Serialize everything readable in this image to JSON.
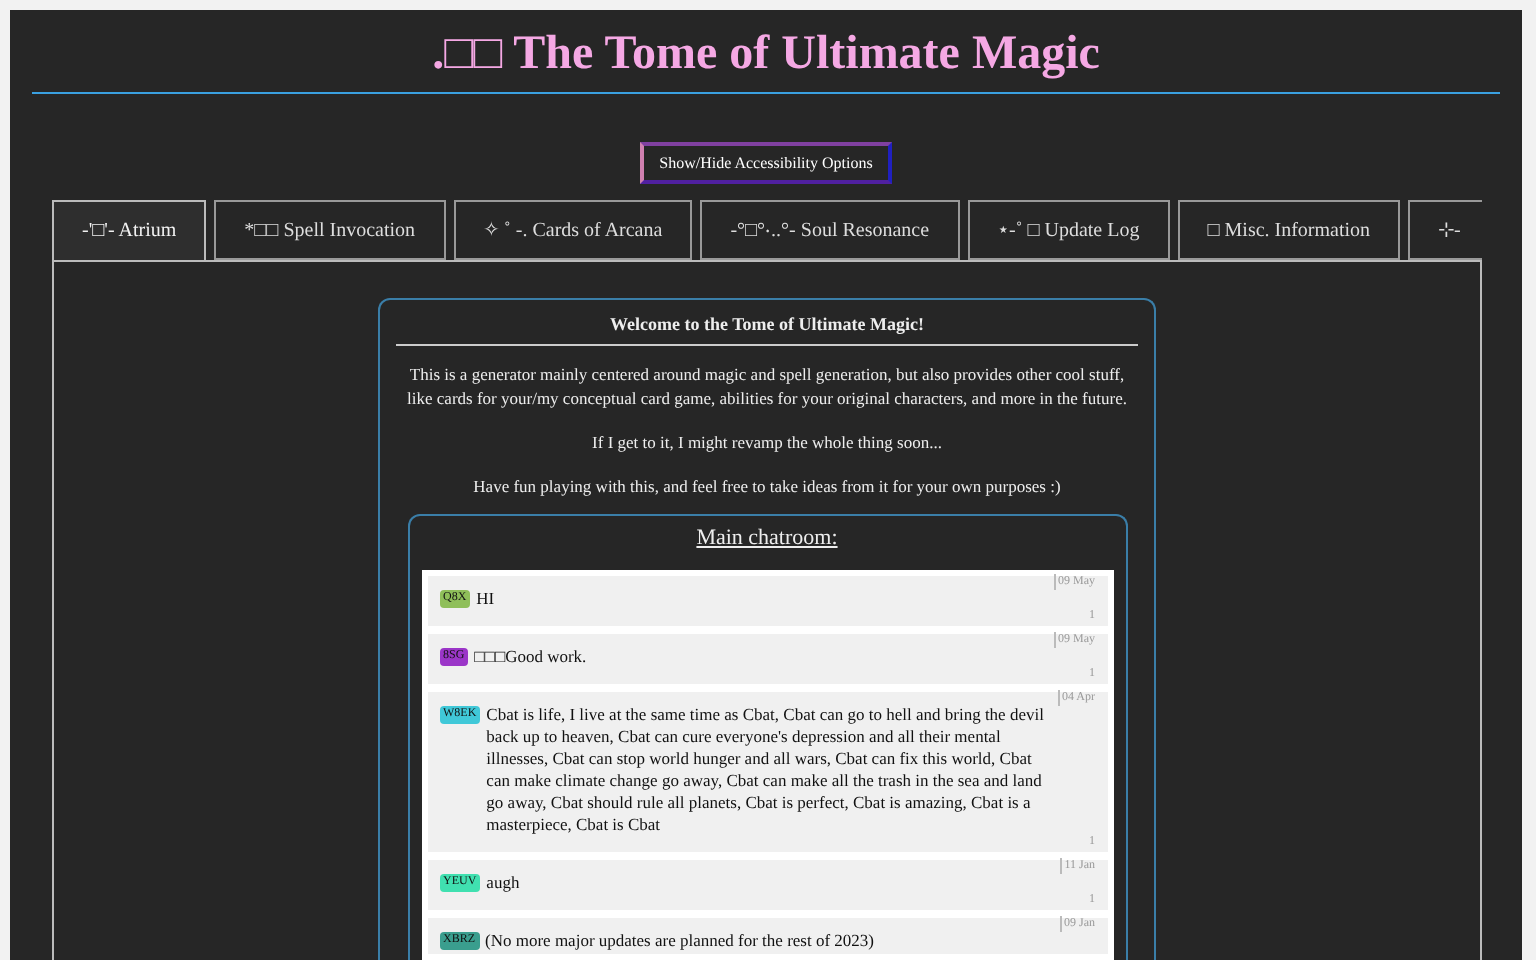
{
  "title": ".□□ The Tome of Ultimate Magic",
  "accessibility_button": "Show/Hide Accessibility Options",
  "tabs": [
    {
      "label": "-'□'- Atrium",
      "selected": true
    },
    {
      "label": "*□□ Spell Invocation",
      "selected": false
    },
    {
      "label": "✧ ˚ -. Cards of Arcana",
      "selected": false
    },
    {
      "label": "-°□°‧..°- Soul Resonance",
      "selected": false
    },
    {
      "label": "⋆-˚ □ Update Log",
      "selected": false
    },
    {
      "label": "□ Misc. Information",
      "selected": false
    },
    {
      "label": "⊹-",
      "selected": false
    }
  ],
  "welcome": {
    "heading": "Welcome to the Tome of Ultimate Magic!",
    "paragraphs": [
      "This is a generator mainly centered around magic and spell generation, but also provides other cool stuff, like cards for your/my conceptual card game, abilities for your original characters, and more in the future.",
      "If I get to it, I might revamp the whole thing soon...",
      "Have fun playing with this, and feel free to take ideas from it for your own purposes :)"
    ]
  },
  "chatroom": {
    "heading": "Main chatroom:",
    "messages": [
      {
        "user": "Q8X",
        "color": "#8fbf5a",
        "text": "HI",
        "date": "09 May",
        "count": "1"
      },
      {
        "user": "8SG",
        "color": "#9b36c8",
        "text": "□□□Good work.",
        "date": "09 May",
        "count": "1"
      },
      {
        "user": "W8EK",
        "color": "#40c8d8",
        "text": "Cbat is life, I live at the same time as Cbat, Cbat can go to hell and bring the devil back up to heaven, Cbat can cure everyone's depression and all their mental illnesses, Cbat can stop world hunger and all wars, Cbat can fix this world, Cbat can make climate change go away, Cbat can make all the trash in the sea and land go away, Cbat should rule all planets, Cbat is perfect, Cbat is amazing, Cbat is a masterpiece, Cbat is Cbat",
        "date": "04 Apr",
        "count": "1"
      },
      {
        "user": "YEUV",
        "color": "#40e0b0",
        "text": "augh",
        "date": "11 Jan",
        "count": "1"
      },
      {
        "user": "XBRZ",
        "color": "#3a9e8e",
        "text": "(No more major updates are planned for the rest of 2023)",
        "date": "09 Jan"
      }
    ]
  }
}
